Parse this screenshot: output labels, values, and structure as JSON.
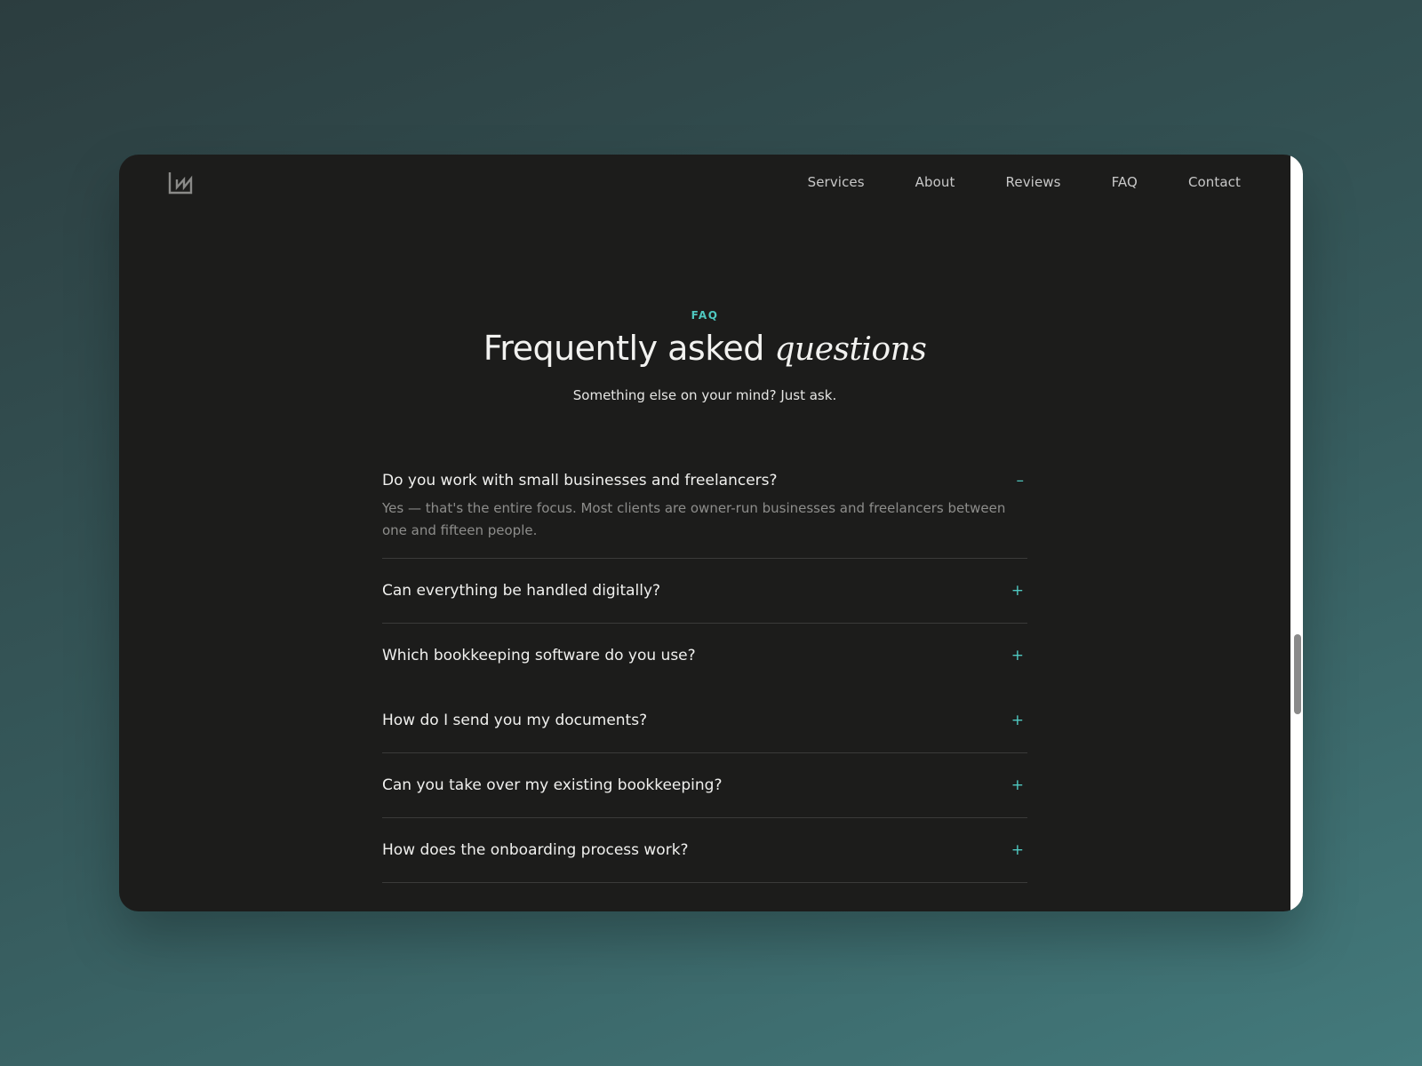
{
  "nav": {
    "logo_icon": "bar-chart-logo-icon",
    "links": [
      "Services",
      "About",
      "Reviews",
      "FAQ",
      "Contact"
    ]
  },
  "faq": {
    "eyebrow": "FAQ",
    "title_plain": "Frequently asked",
    "title_italic": "questions",
    "subtitle": "Something else on your mind? Just ask.",
    "items": [
      {
        "question": "Do you work with small businesses and freelancers?",
        "toggle": "–",
        "open": true,
        "answer": "Yes — that's the entire focus. Most clients are owner-run businesses and freelancers between one and fifteen people."
      },
      {
        "question": "Can everything be handled digitally?",
        "toggle": "+",
        "open": false
      },
      {
        "question": "Which bookkeeping software do you use?",
        "toggle": "+",
        "open": false
      },
      {
        "question": "How do I send you my documents?",
        "toggle": "+",
        "open": false
      },
      {
        "question": "Can you take over my existing bookkeeping?",
        "toggle": "+",
        "open": false
      },
      {
        "question": "How does the onboarding process work?",
        "toggle": "+",
        "open": false
      }
    ]
  },
  "colors": {
    "accent": "#4fc8c0",
    "surface": "#1c1c1b",
    "text": "#f0f0ee",
    "muted": "#8d8d8b"
  }
}
